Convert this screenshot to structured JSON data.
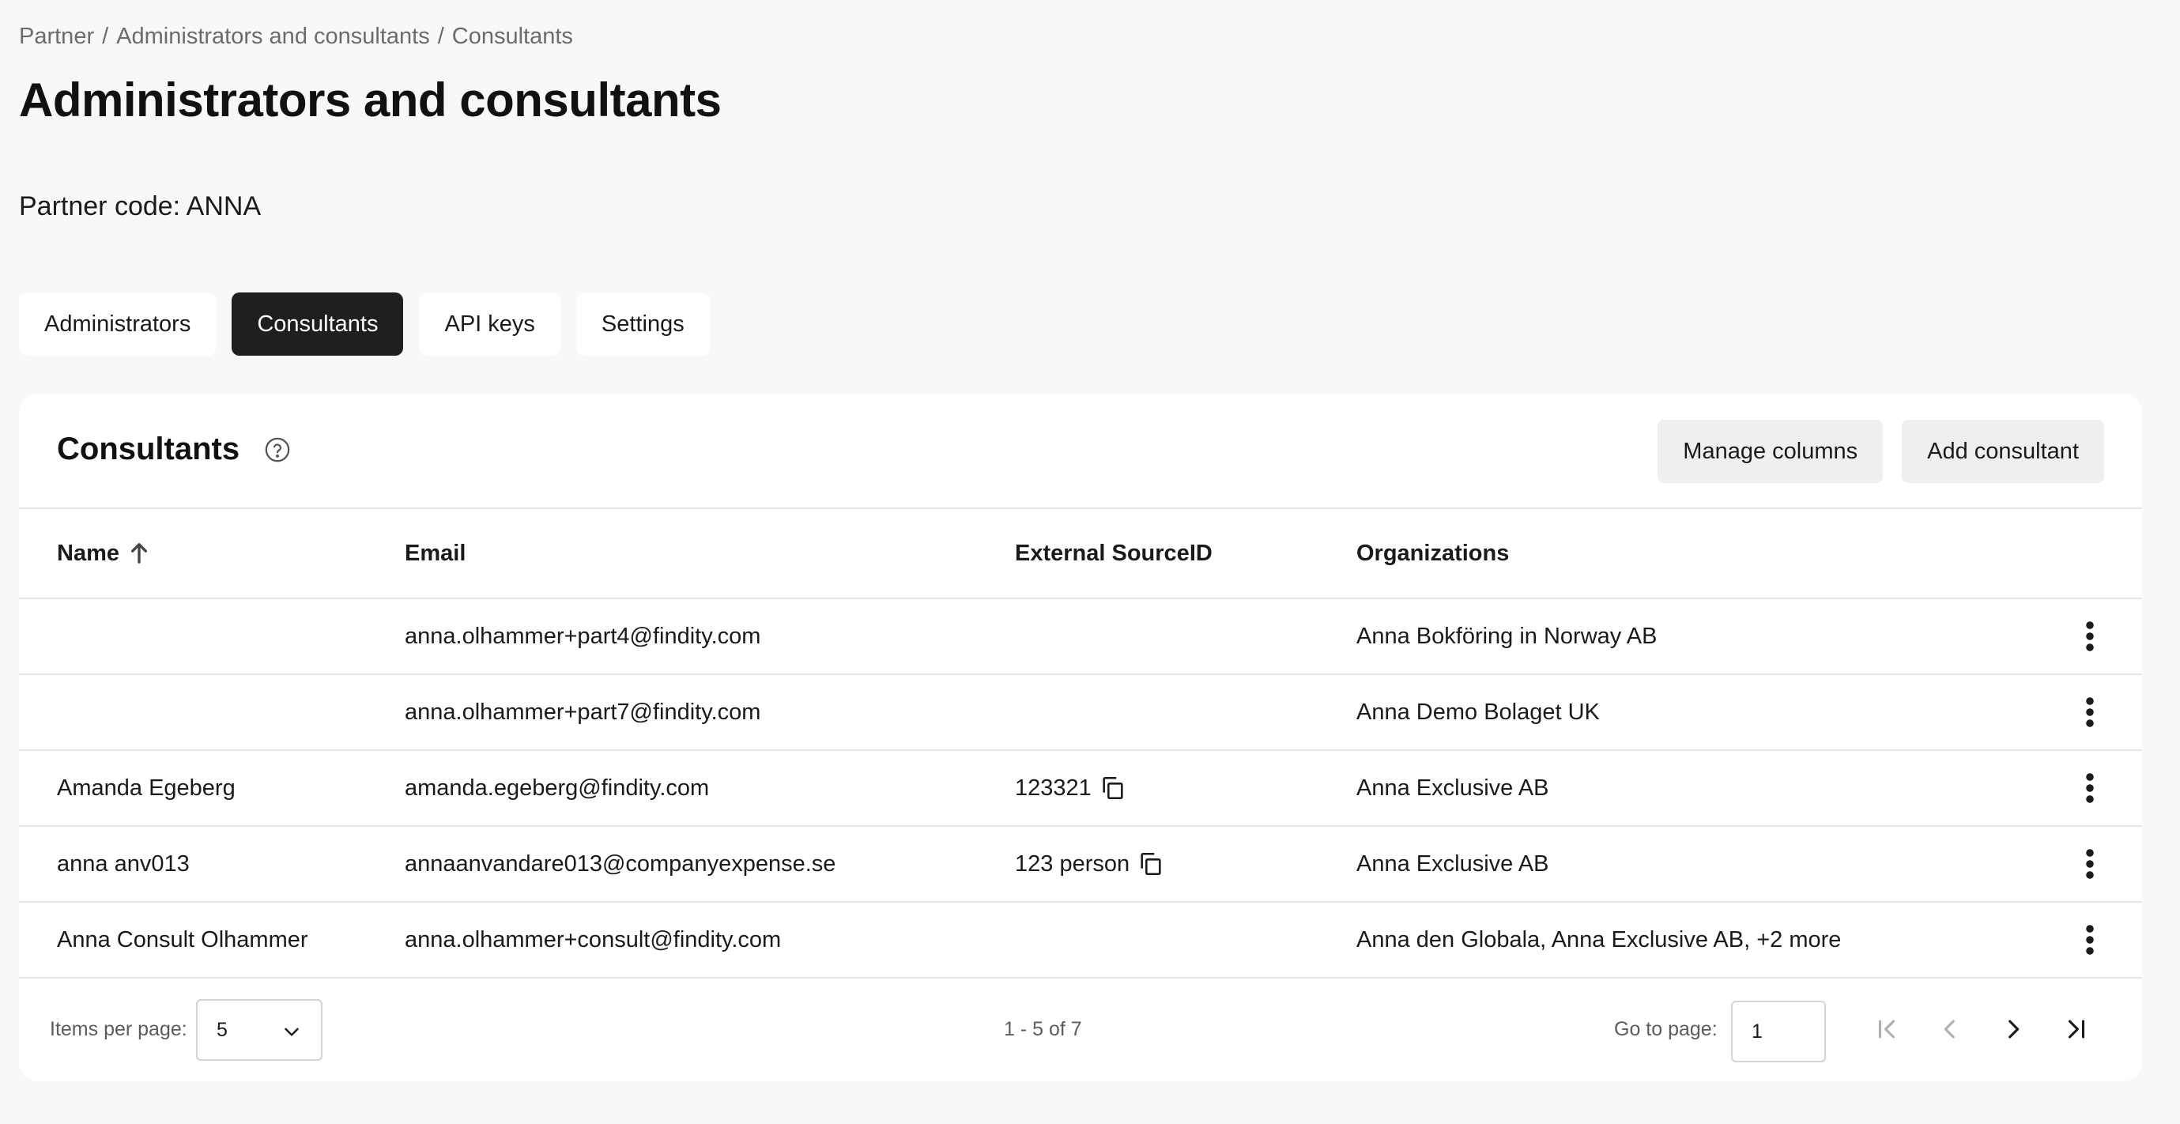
{
  "breadcrumb": {
    "items": [
      "Partner",
      "Administrators and consultants",
      "Consultants"
    ],
    "separator": "/"
  },
  "page": {
    "title": "Administrators and consultants",
    "partner_code": "Partner code: ANNA"
  },
  "tabs": [
    {
      "label": "Administrators",
      "active": false
    },
    {
      "label": "Consultants",
      "active": true
    },
    {
      "label": "API keys",
      "active": false
    },
    {
      "label": "Settings",
      "active": false
    }
  ],
  "card": {
    "title": "Consultants",
    "manage_columns_label": "Manage columns",
    "add_consultant_label": "Add consultant"
  },
  "table": {
    "columns": {
      "name": "Name",
      "email": "Email",
      "external_source_id": "External SourceID",
      "organizations": "Organizations"
    },
    "sort": {
      "column": "name",
      "direction": "ascending"
    },
    "rows": [
      {
        "name": "",
        "email": "anna.olhammer+part4@findity.com",
        "external_source_id": "",
        "organizations": "Anna Bokföring in Norway AB"
      },
      {
        "name": "",
        "email": "anna.olhammer+part7@findity.com",
        "external_source_id": "",
        "organizations": "Anna Demo Bolaget UK"
      },
      {
        "name": "Amanda Egeberg",
        "email": "amanda.egeberg@findity.com",
        "external_source_id": "123321",
        "organizations": "Anna Exclusive AB"
      },
      {
        "name": "anna anv013",
        "email": "annaanvandare013@companyexpense.se",
        "external_source_id": "123 person",
        "organizations": "Anna Exclusive AB"
      },
      {
        "name": "Anna Consult Olhammer",
        "email": "anna.olhammer+consult@findity.com",
        "external_source_id": "",
        "organizations": "Anna den Globala, Anna Exclusive AB, +2 more"
      }
    ]
  },
  "pagination": {
    "items_per_page_label": "Items per page:",
    "items_per_page_value": "5",
    "range_text": "1 - 5 of 7",
    "go_to_page_label": "Go to page:",
    "go_to_page_value": "1"
  },
  "colors": {
    "background": "#f8f8f8",
    "card": "#ffffff",
    "active_tab": "#1f1f1f",
    "secondary_button": "#efefef",
    "border": "#e6e6e6",
    "muted_text": "#6b6b6b"
  },
  "icons": {
    "help": "help-circle-icon",
    "sort": "arrow-up-icon",
    "copy": "copy-icon",
    "row_menu": "kebab-menu-icon",
    "select": "chevron-down-icon",
    "first_page": "first-page-icon",
    "prev_page": "chevron-left-icon",
    "next_page": "chevron-right-icon",
    "last_page": "last-page-icon"
  }
}
